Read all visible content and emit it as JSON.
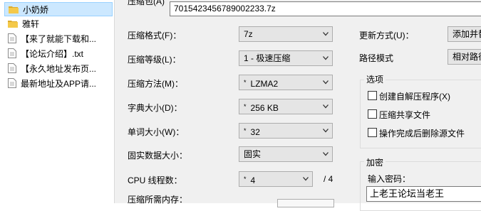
{
  "file_list": {
    "items": [
      {
        "name": "小奶娇",
        "type": "folder",
        "selected": true
      },
      {
        "name": "雅轩",
        "type": "folder",
        "selected": false
      },
      {
        "name": "【来了就能下载和...",
        "type": "file",
        "selected": false
      },
      {
        "name": "【论坛介绍】.txt",
        "type": "file",
        "selected": false
      },
      {
        "name": "【永久地址发布页...",
        "type": "file",
        "selected": false
      },
      {
        "name": "最新地址及APP请...",
        "type": "file",
        "selected": false
      }
    ]
  },
  "dialog": {
    "archive_label": "压缩包(A)",
    "archive_value": "7015423456789002233.7z",
    "format": {
      "label": "压缩格式(F)：",
      "value": "7z"
    },
    "level": {
      "label": "压缩等级(L)：",
      "value": "1 - 极速压缩"
    },
    "method": {
      "label": "压缩方法(M)：",
      "value": "LZMA2"
    },
    "dict": {
      "label": "字典大小(D)：",
      "value": "256 KB"
    },
    "word": {
      "label": "单词大小(W)：",
      "value": "32"
    },
    "solid": {
      "label": "固实数据大小：",
      "value": "固实"
    },
    "cpu": {
      "label": "CPU 线程数：",
      "value": "4",
      "total": "/ 4"
    },
    "memory": {
      "label": "压缩所需内存："
    },
    "update": {
      "label": "更新方式(U)：",
      "value": "添加并替"
    },
    "path_mode": {
      "label": "路径模式",
      "value": "相对路径"
    },
    "options": {
      "title": "选项",
      "sfx": "创建自解压程序(X)",
      "shared": "压缩共享文件",
      "delete": "操作完成后删除源文件"
    },
    "encryption": {
      "title": "加密",
      "password_label": "输入密码：",
      "password_value": "上老王论坛当老王"
    }
  },
  "icons": {
    "folder": "folder-icon",
    "file": "text-file-icon",
    "dropdown": "chevron-down-icon",
    "checkbox": "checkbox-unchecked"
  },
  "colors": {
    "selected_bg": "#cce8ff",
    "dialog_bg": "#f0f0f0",
    "folder": "#e8b42f"
  }
}
